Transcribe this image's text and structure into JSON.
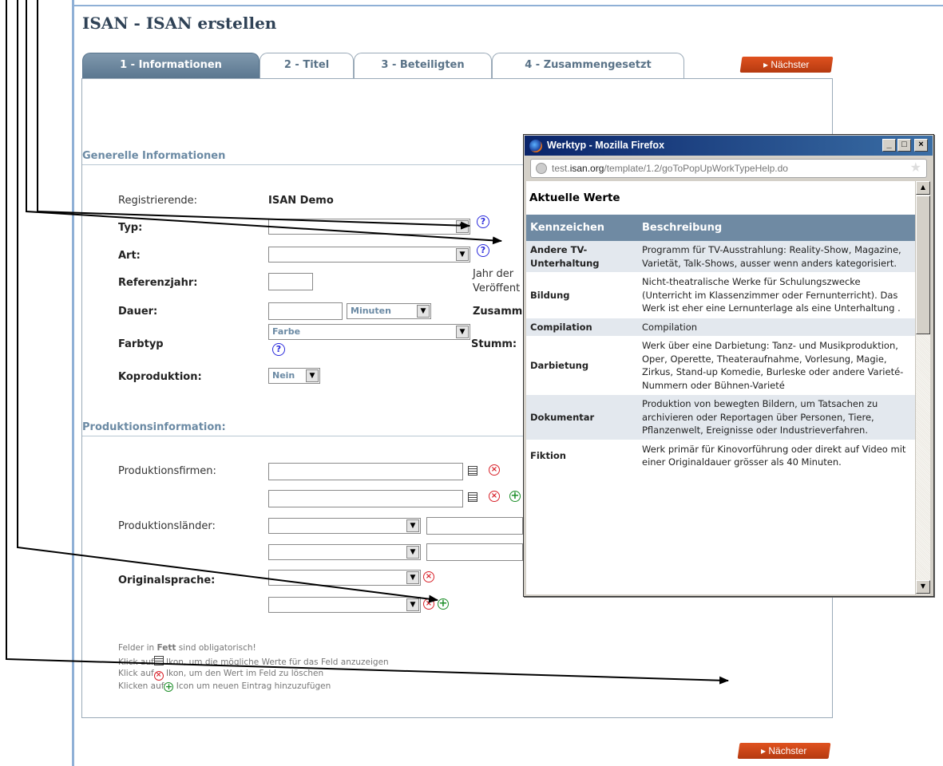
{
  "page_title": "ISAN - ISAN erstellen",
  "tabs": [
    {
      "label": "1 - Informationen",
      "active": true
    },
    {
      "label": "2 - Titel",
      "active": false
    },
    {
      "label": "3 - Beteiligten",
      "active": false
    },
    {
      "label": "4 - Zusammengesetzt",
      "active": false
    }
  ],
  "next_button": "▸ Nächster",
  "general": {
    "title": "Generelle Informationen",
    "registrant_label": "Registrierende:",
    "registrant_value": "ISAN Demo",
    "type_label": "Typ:",
    "kind_label": "Art:",
    "ref_year_label": "Referenzjahr:",
    "ref_year_note_1": "Jahr der",
    "ref_year_note_2": "Veröffent",
    "duration_label": "Dauer:",
    "duration_unit": "Minuten",
    "composite_label": "Zusamm",
    "color_label": "Farbtyp",
    "color_value": "Farbe",
    "silent_label": "Stumm:",
    "coproduction_label": "Koproduktion:",
    "coproduction_value": "Nein"
  },
  "production": {
    "title": "Produktionsinformation:",
    "companies_label": "Produktionsfirmen:",
    "countries_label": "Produktionsländer:",
    "language_label": "Originalsprache:"
  },
  "notes": {
    "line1_pre": "Felder in ",
    "line1_bold": "Fett",
    "line1_post": " sind obligatorisch!",
    "line2_pre": "Klick auf",
    "line2_post": " Ikon, um die mögliche Werte für das Feld anzuzeigen",
    "line3_pre": "Klick auf",
    "line3_post": " Ikon, um den Wert im Feld zu löschen",
    "line4_pre": "Klicken auf",
    "line4_post": " Icon um neuen Eintrag hinzuzufügen"
  },
  "popup": {
    "window_title": "Werktyp - Mozilla Firefox",
    "url_host": "test.isan.org",
    "url_path": "/template/1.2/goToPopUpWorkTypeHelp.do",
    "url_prefix": "test.",
    "url_domain": "isan.org",
    "heading": "Aktuelle Werte",
    "col_key": "Kennzeichen",
    "col_desc": "Beschreibung",
    "rows": [
      {
        "key": "Andere TV-Unterhaltung",
        "desc": "Programm für TV-Ausstrahlung: Reality-Show, Magazine, Varietät, Talk-Shows, ausser wenn anders kategorisiert."
      },
      {
        "key": "Bildung",
        "desc": "Nicht-theatralische Werke für Schulungszwecke (Unterricht im Klassenzimmer oder Fernunterricht). Das Werk ist eher eine Lernunterlage als eine Unterhaltung ."
      },
      {
        "key": "Compilation",
        "desc": "Compilation"
      },
      {
        "key": "Darbietung",
        "desc": "Werk über eine Darbietung: Tanz- und Musikproduktion, Oper, Operette, Theateraufnahme, Vorlesung, Magie, Zirkus, Stand-up Komedie, Burleske oder andere Varieté-Nummern oder Bühnen-Varieté"
      },
      {
        "key": "Dokumentar",
        "desc": "Produktion von bewegten Bildern, um Tatsachen zu archivieren oder Reportagen über Personen, Tiere, Pflanzenwelt, Ereignisse oder Industrieverfahren."
      },
      {
        "key": "Fiktion",
        "desc": "Werk primär für Kinovorführung oder direkt auf Video mit einer Originaldauer grösser als 40 Minuten."
      }
    ]
  },
  "colors": {
    "tab_active": "#5a768f",
    "next_button": "#c8441a",
    "section_title": "#6b8aa4",
    "table_header": "#6f8aa3"
  }
}
